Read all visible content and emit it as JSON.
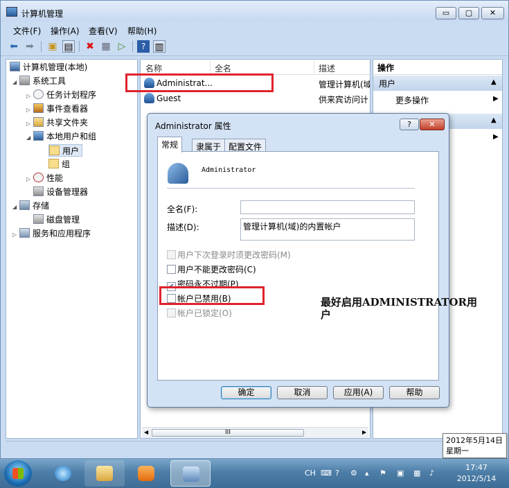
{
  "window": {
    "title": "计算机管理",
    "caption": {
      "minimize": "▭",
      "maximize": "▢",
      "close": "✕"
    }
  },
  "menu": [
    "文件(F)",
    "操作(A)",
    "查看(V)",
    "帮助(H)"
  ],
  "toolbar_icons": [
    "back-arrow-icon",
    "forward-arrow-icon",
    "up-folder-icon",
    "show-hide-tree-icon",
    "delete-icon",
    "properties-icon",
    "export-list-icon",
    "help-icon",
    "show-hide-action-pane-icon"
  ],
  "tree": [
    {
      "label": "计算机管理(本地)",
      "icon": "computer-management-icon",
      "twisty": ""
    },
    {
      "label": "系统工具",
      "icon": "tools-icon",
      "twisty": "◢"
    },
    {
      "label": "任务计划程序",
      "icon": "clock-icon",
      "twisty": "▷"
    },
    {
      "label": "事件查看器",
      "icon": "event-viewer-icon",
      "twisty": "▷"
    },
    {
      "label": "共享文件夹",
      "icon": "shared-folder-icon",
      "twisty": "▷"
    },
    {
      "label": "本地用户和组",
      "icon": "users-icon",
      "twisty": "◢"
    },
    {
      "label": "用户",
      "icon": "folder-icon",
      "twisty": ""
    },
    {
      "label": "组",
      "icon": "folder-icon",
      "twisty": ""
    },
    {
      "label": "性能",
      "icon": "performance-icon",
      "twisty": "▷"
    },
    {
      "label": "设备管理器",
      "icon": "device-manager-icon",
      "twisty": ""
    },
    {
      "label": "存储",
      "icon": "storage-icon",
      "twisty": "◢"
    },
    {
      "label": "磁盘管理",
      "icon": "disk-icon",
      "twisty": ""
    },
    {
      "label": "服务和应用程序",
      "icon": "services-icon",
      "twisty": "▷"
    }
  ],
  "list": {
    "columns": [
      "名称",
      "全名",
      "描述"
    ],
    "rows": [
      {
        "name": "Administrat...",
        "full": "",
        "desc": "管理计算机(域"
      },
      {
        "name": "Guest",
        "full": "",
        "desc": "供来宾访问计"
      }
    ],
    "scroll_thumb": "III"
  },
  "actions": {
    "header": "操作",
    "section1": "用户",
    "item1": "更多操作",
    "section2": "",
    "arrow_up": "▲",
    "arrow_right": "▶"
  },
  "dialog": {
    "title": "Administrator 属性",
    "help": "?",
    "close": "✕",
    "tabs": [
      "常规",
      "隶属于",
      "配置文件"
    ],
    "user_name": "Administrator",
    "fullname_label": "全名(F):",
    "fullname_value": "",
    "desc_label": "描述(D):",
    "desc_value": "管理计算机(域)的内置帐户",
    "checkboxes": [
      {
        "label": "用户下次登录时须更改密码(M)",
        "checked": false,
        "disabled": true
      },
      {
        "label": "用户不能更改密码(C)",
        "checked": false,
        "disabled": false
      },
      {
        "label": "密码永不过期(P)",
        "checked": true,
        "disabled": false
      },
      {
        "label": "帐户已禁用(B)",
        "checked": false,
        "disabled": false
      },
      {
        "label": "帐户已锁定(O)",
        "checked": false,
        "disabled": true
      }
    ],
    "buttons": [
      "确定",
      "取消",
      "应用(A)",
      "帮助"
    ]
  },
  "annotation": "最好启用ADMINISTRATOR用户",
  "tooltip": {
    "date": "2012年5月14日",
    "weekday": "星期一"
  },
  "taskbar": {
    "tray_lang": "CH",
    "time": "17:47",
    "date": "2012/5/14"
  },
  "colors": {
    "highlight": "#e0222c",
    "accent": "#3c7fb1"
  }
}
